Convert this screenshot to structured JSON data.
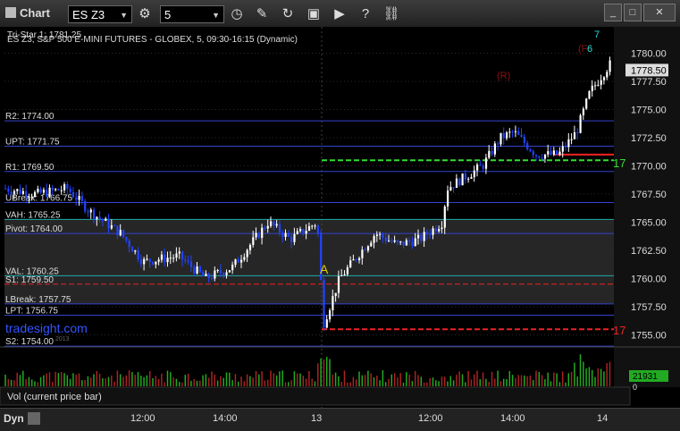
{
  "window": {
    "title": "Chart",
    "symbol": "ES Z3",
    "interval": "5",
    "chart_label": "ES Z3, S&P 500 E-MINI FUTURES - GLOBEX, 5, 09:30-16:15 (Dynamic)",
    "tri_star": "Tri-Star 1: 1781.25",
    "watermark": "tradesight.com",
    "watermark_sub": "2013",
    "volume_label": "Vol (current price bar)",
    "dyn_label": "Dyn",
    "icons": [
      "symbol-settings-icon",
      "clock-icon",
      "pencil-icon",
      "refresh-icon",
      "screenshot-icon",
      "play-icon",
      "help-icon",
      "link-icon"
    ]
  },
  "price_scale": [
    "1780.00",
    "1777.50",
    "1775.00",
    "1772.50",
    "1770.00",
    "1767.50",
    "1765.00",
    "1762.50",
    "1760.00",
    "1757.50",
    "1755.00"
  ],
  "current_price": "1778.50",
  "volume_value": "21931",
  "volume_zero": "0",
  "time_labels": [
    "12:00",
    "14:00",
    "13",
    "12:00",
    "14:00",
    "14"
  ],
  "levels": [
    {
      "label": "R2: 1774.00",
      "value": 1774.0
    },
    {
      "label": "UPT: 1771.75",
      "value": 1771.75
    },
    {
      "label": "R1: 1769.50",
      "value": 1769.5
    },
    {
      "label": "UBreak: 1766.75",
      "value": 1766.75
    },
    {
      "label": "VAH: 1765.25",
      "value": 1765.25
    },
    {
      "label": "Pivot: 1764.00",
      "value": 1764.0
    },
    {
      "label": "VAL: 1760.25",
      "value": 1760.25
    },
    {
      "label": "S1: 1759.50",
      "value": 1759.5
    },
    {
      "label": "LBreak: 1757.75",
      "value": 1757.75
    },
    {
      "label": "LPT: 1756.75",
      "value": 1756.75
    },
    {
      "label": "S2: 1754.00",
      "value": 1754.0
    }
  ],
  "markers": {
    "a_label": "A",
    "r_label": "(R)",
    "f_label": "(F",
    "top_label": "7",
    "top_label2": "6",
    "right_green": "17",
    "right_red": "17"
  },
  "colors": {
    "bull": "#ffffff",
    "bear": "#2244ff",
    "green_dash": "#33dd33",
    "red_dash": "#ee2222",
    "level": "#3344cc",
    "accent_yellow": "#e8d000",
    "accent_cyan": "#22dddd",
    "value_area": "#262626"
  }
}
